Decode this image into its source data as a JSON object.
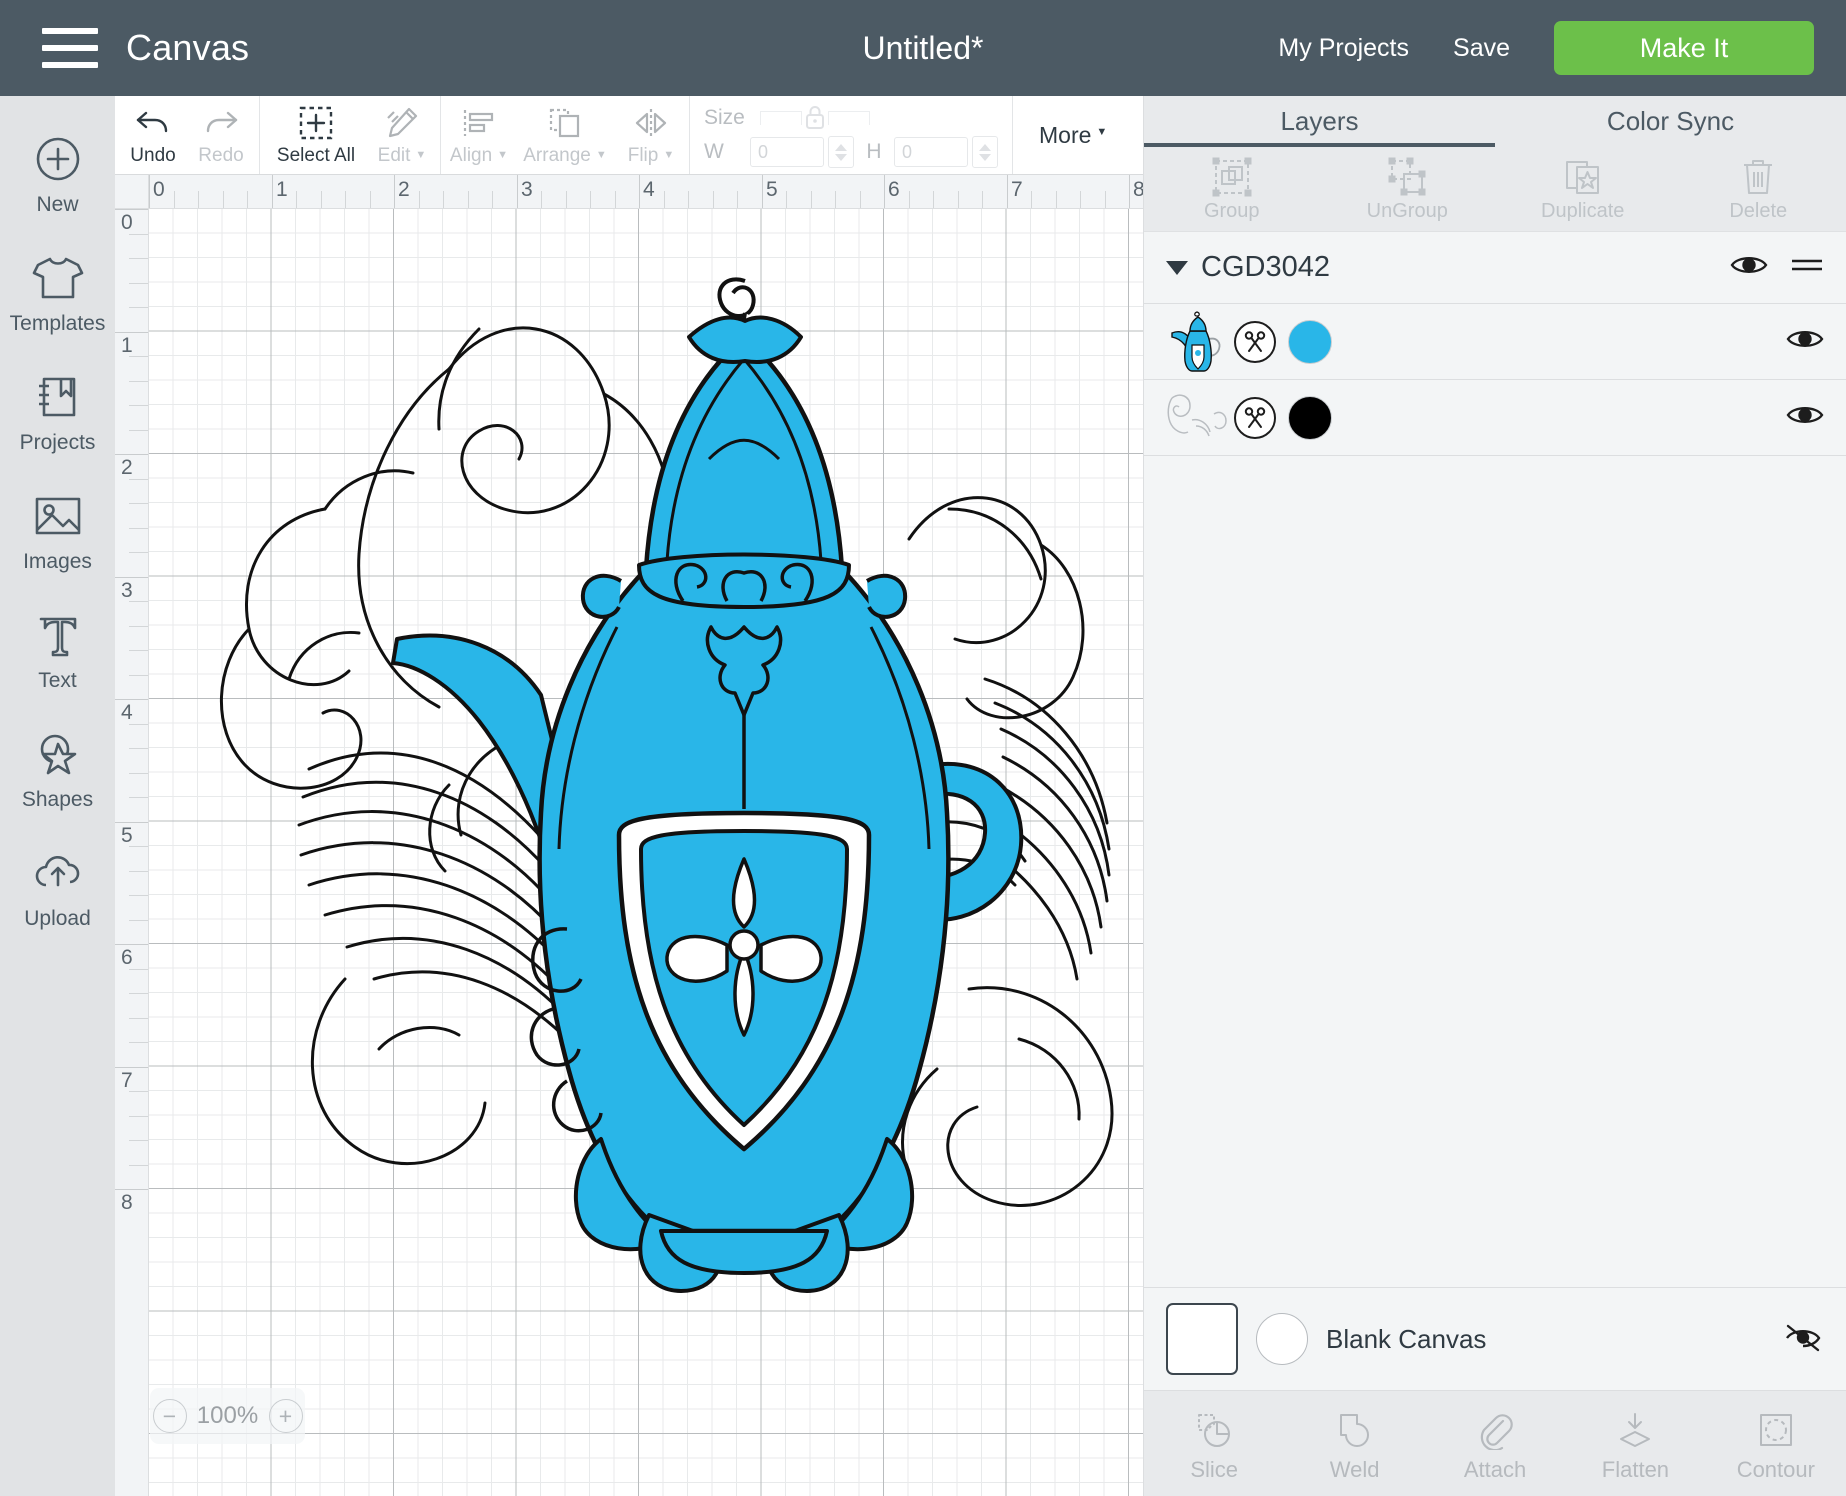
{
  "header": {
    "menu_icon": "hamburger-icon",
    "app_title": "Canvas",
    "doc_title": "Untitled*",
    "my_projects": "My Projects",
    "save": "Save",
    "make_it": "Make It",
    "bg_color": "#4c5a64",
    "make_it_color": "#6cc04a"
  },
  "sidebar": {
    "items": [
      {
        "label": "New",
        "icon": "plus-circle-icon"
      },
      {
        "label": "Templates",
        "icon": "tshirt-icon"
      },
      {
        "label": "Projects",
        "icon": "notebook-bookmark-icon"
      },
      {
        "label": "Images",
        "icon": "picture-icon"
      },
      {
        "label": "Text",
        "icon": "text-t-icon"
      },
      {
        "label": "Shapes",
        "icon": "shapes-star-icon"
      },
      {
        "label": "Upload",
        "icon": "upload-cloud-icon"
      }
    ]
  },
  "toolbar": {
    "undo": "Undo",
    "redo": "Redo",
    "select_all": "Select All",
    "edit": "Edit",
    "align": "Align",
    "arrange": "Arrange",
    "flip": "Flip",
    "size_label": "Size",
    "w_label": "W",
    "h_label": "H",
    "w_value": "0",
    "h_value": "0",
    "more": "More"
  },
  "canvas": {
    "ruler_h_labels": [
      "0",
      "1",
      "2",
      "3",
      "4",
      "5",
      "6",
      "7",
      "8"
    ],
    "ruler_v_labels": [
      "0",
      "1",
      "2",
      "3",
      "4",
      "5",
      "6",
      "7",
      "8"
    ],
    "zoom_level": "100%",
    "zoom_out": "−",
    "zoom_in": "+",
    "artwork_name": "ornate-teapot-with-flourishes",
    "artwork_fill": "#29b6e8",
    "artwork_stroke": "#111111"
  },
  "right_panel": {
    "tabs": [
      {
        "label": "Layers",
        "active": true
      },
      {
        "label": "Color Sync",
        "active": false
      }
    ],
    "group_actions": [
      {
        "label": "Group",
        "icon": "group-icon",
        "enabled": false
      },
      {
        "label": "UnGroup",
        "icon": "ungroup-icon",
        "enabled": false
      },
      {
        "label": "Duplicate",
        "icon": "duplicate-icon",
        "enabled": false
      },
      {
        "label": "Delete",
        "icon": "trash-icon",
        "enabled": false
      }
    ],
    "layer_group": {
      "name": "CGD3042",
      "expanded": true,
      "visibility_icon": "eye-icon",
      "menu_icon": "more-lines-icon"
    },
    "layers": [
      {
        "thumb": "teapot-blue-thumb",
        "operation_icon": "scissors-cut-icon",
        "color": "#29b6e8",
        "visibility_icon": "eye-icon"
      },
      {
        "thumb": "flourish-black-thumb",
        "operation_icon": "scissors-cut-icon",
        "color": "#000000",
        "visibility_icon": "eye-icon"
      }
    ],
    "blank_canvas": {
      "label": "Blank Canvas",
      "visibility_icon": "eye-hidden-icon"
    },
    "bottom_tools": [
      {
        "label": "Slice",
        "icon": "slice-icon"
      },
      {
        "label": "Weld",
        "icon": "weld-icon"
      },
      {
        "label": "Attach",
        "icon": "paperclip-icon"
      },
      {
        "label": "Flatten",
        "icon": "flatten-icon"
      },
      {
        "label": "Contour",
        "icon": "contour-icon"
      }
    ]
  }
}
